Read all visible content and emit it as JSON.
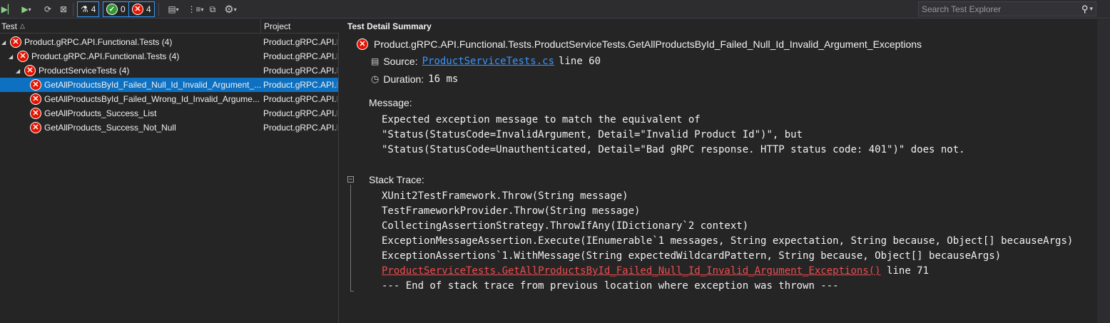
{
  "toolbar": {
    "flask_count": "4",
    "passed_count": "0",
    "failed_count": "4",
    "search_placeholder": "Search Test Explorer"
  },
  "tree": {
    "col_test": "Test",
    "col_project": "Project",
    "rows": [
      {
        "name": "Product.gRPC.API.Functional.Tests (4)",
        "project": "Product.gRPC.API.Functional.Tests"
      },
      {
        "name": "Product.gRPC.API.Functional.Tests (4)",
        "project": "Product.gRPC.API.Functional.Tests"
      },
      {
        "name": "ProductServiceTests (4)",
        "project": "Product.gRPC.API.Functional.Tests"
      },
      {
        "name": "GetAllProductsById_Failed_Null_Id_Invalid_Argument_...",
        "project": "Product.gRPC.API.Functional.Tests"
      },
      {
        "name": "GetAllProductsById_Failed_Wrong_Id_Invalid_Argume...",
        "project": "Product.gRPC.API.Functional.Tests"
      },
      {
        "name": "GetAllProducts_Success_List",
        "project": "Product.gRPC.API.Functional.Tests"
      },
      {
        "name": "GetAllProducts_Success_Not_Null",
        "project": "Product.gRPC.API.Functional.Tests"
      }
    ]
  },
  "detail": {
    "summary_title": "Test Detail Summary",
    "test_name": "Product.gRPC.API.Functional.Tests.ProductServiceTests.GetAllProductsById_Failed_Null_Id_Invalid_Argument_Exceptions",
    "source_label": "Source:",
    "source_file": "ProductServiceTests.cs",
    "source_line": "line 60",
    "duration_label": "Duration:",
    "duration_value": "16 ms",
    "message_label": "Message:",
    "message_lines": [
      "Expected exception message to match the equivalent of",
      "\"Status(StatusCode=InvalidArgument, Detail=\"Invalid Product Id\")\", but",
      "\"Status(StatusCode=Unauthenticated, Detail=\"Bad gRPC response. HTTP status code: 401\")\" does not."
    ],
    "stack_label": "Stack Trace:",
    "stack_lines": [
      "XUnit2TestFramework.Throw(String message)",
      "TestFrameworkProvider.Throw(String message)",
      "CollectingAssertionStrategy.ThrowIfAny(IDictionary`2 context)",
      "ExceptionMessageAssertion.Execute(IEnumerable`1 messages, String expectation, String because, Object[] becauseArgs)",
      "ExceptionAssertions`1.WithMessage(String expectedWildcardPattern, String because, Object[] becauseArgs)"
    ],
    "stack_link": "ProductServiceTests.GetAllProductsById_Failed_Null_Id_Invalid_Argument_Exceptions()",
    "stack_link_line": "line 71",
    "stack_end": "--- End of stack trace from previous location where exception was thrown ---"
  }
}
